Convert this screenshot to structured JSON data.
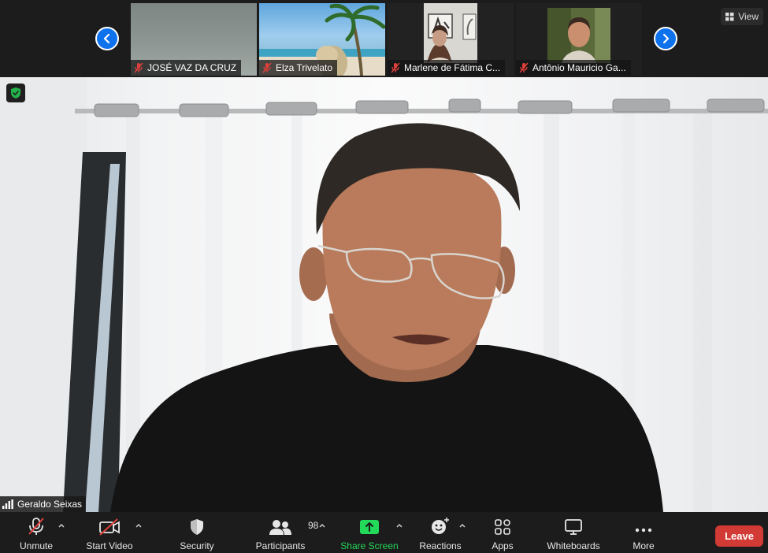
{
  "filmstrip": {
    "participants": [
      {
        "name": "JOSÉ VAZ DA CRUZ",
        "muted": true
      },
      {
        "name": "Elza Trivelato",
        "muted": true
      },
      {
        "name": "Marlene de Fátima C...",
        "muted": true
      },
      {
        "name": "Antônio Mauricio Ga...",
        "muted": true
      }
    ],
    "view_label": "View"
  },
  "main": {
    "speaker_name": "Geraldo Seixas"
  },
  "toolbar": {
    "unmute_label": "Unmute",
    "start_video_label": "Start Video",
    "security_label": "Security",
    "participants_label": "Participants",
    "participants_count": "98",
    "share_screen_label": "Share Screen",
    "reactions_label": "Reactions",
    "apps_label": "Apps",
    "whiteboards_label": "Whiteboards",
    "more_label": "More",
    "leave_label": "Leave"
  },
  "colors": {
    "accent_blue": "#0e72ed",
    "share_green": "#23d959",
    "leave_red": "#d23a35",
    "muted_red": "#e0403a",
    "encryption_green": "#23b34a"
  },
  "icons": [
    "chevron-left-icon",
    "chevron-right-icon",
    "mic-muted-icon",
    "grid-view-icon",
    "shield-check-icon",
    "signal-bars-icon",
    "video-off-icon",
    "security-shield-icon",
    "participants-icon",
    "share-screen-icon",
    "reactions-icon",
    "apps-icon",
    "whiteboards-icon",
    "more-dots-icon",
    "caret-up-icon"
  ]
}
